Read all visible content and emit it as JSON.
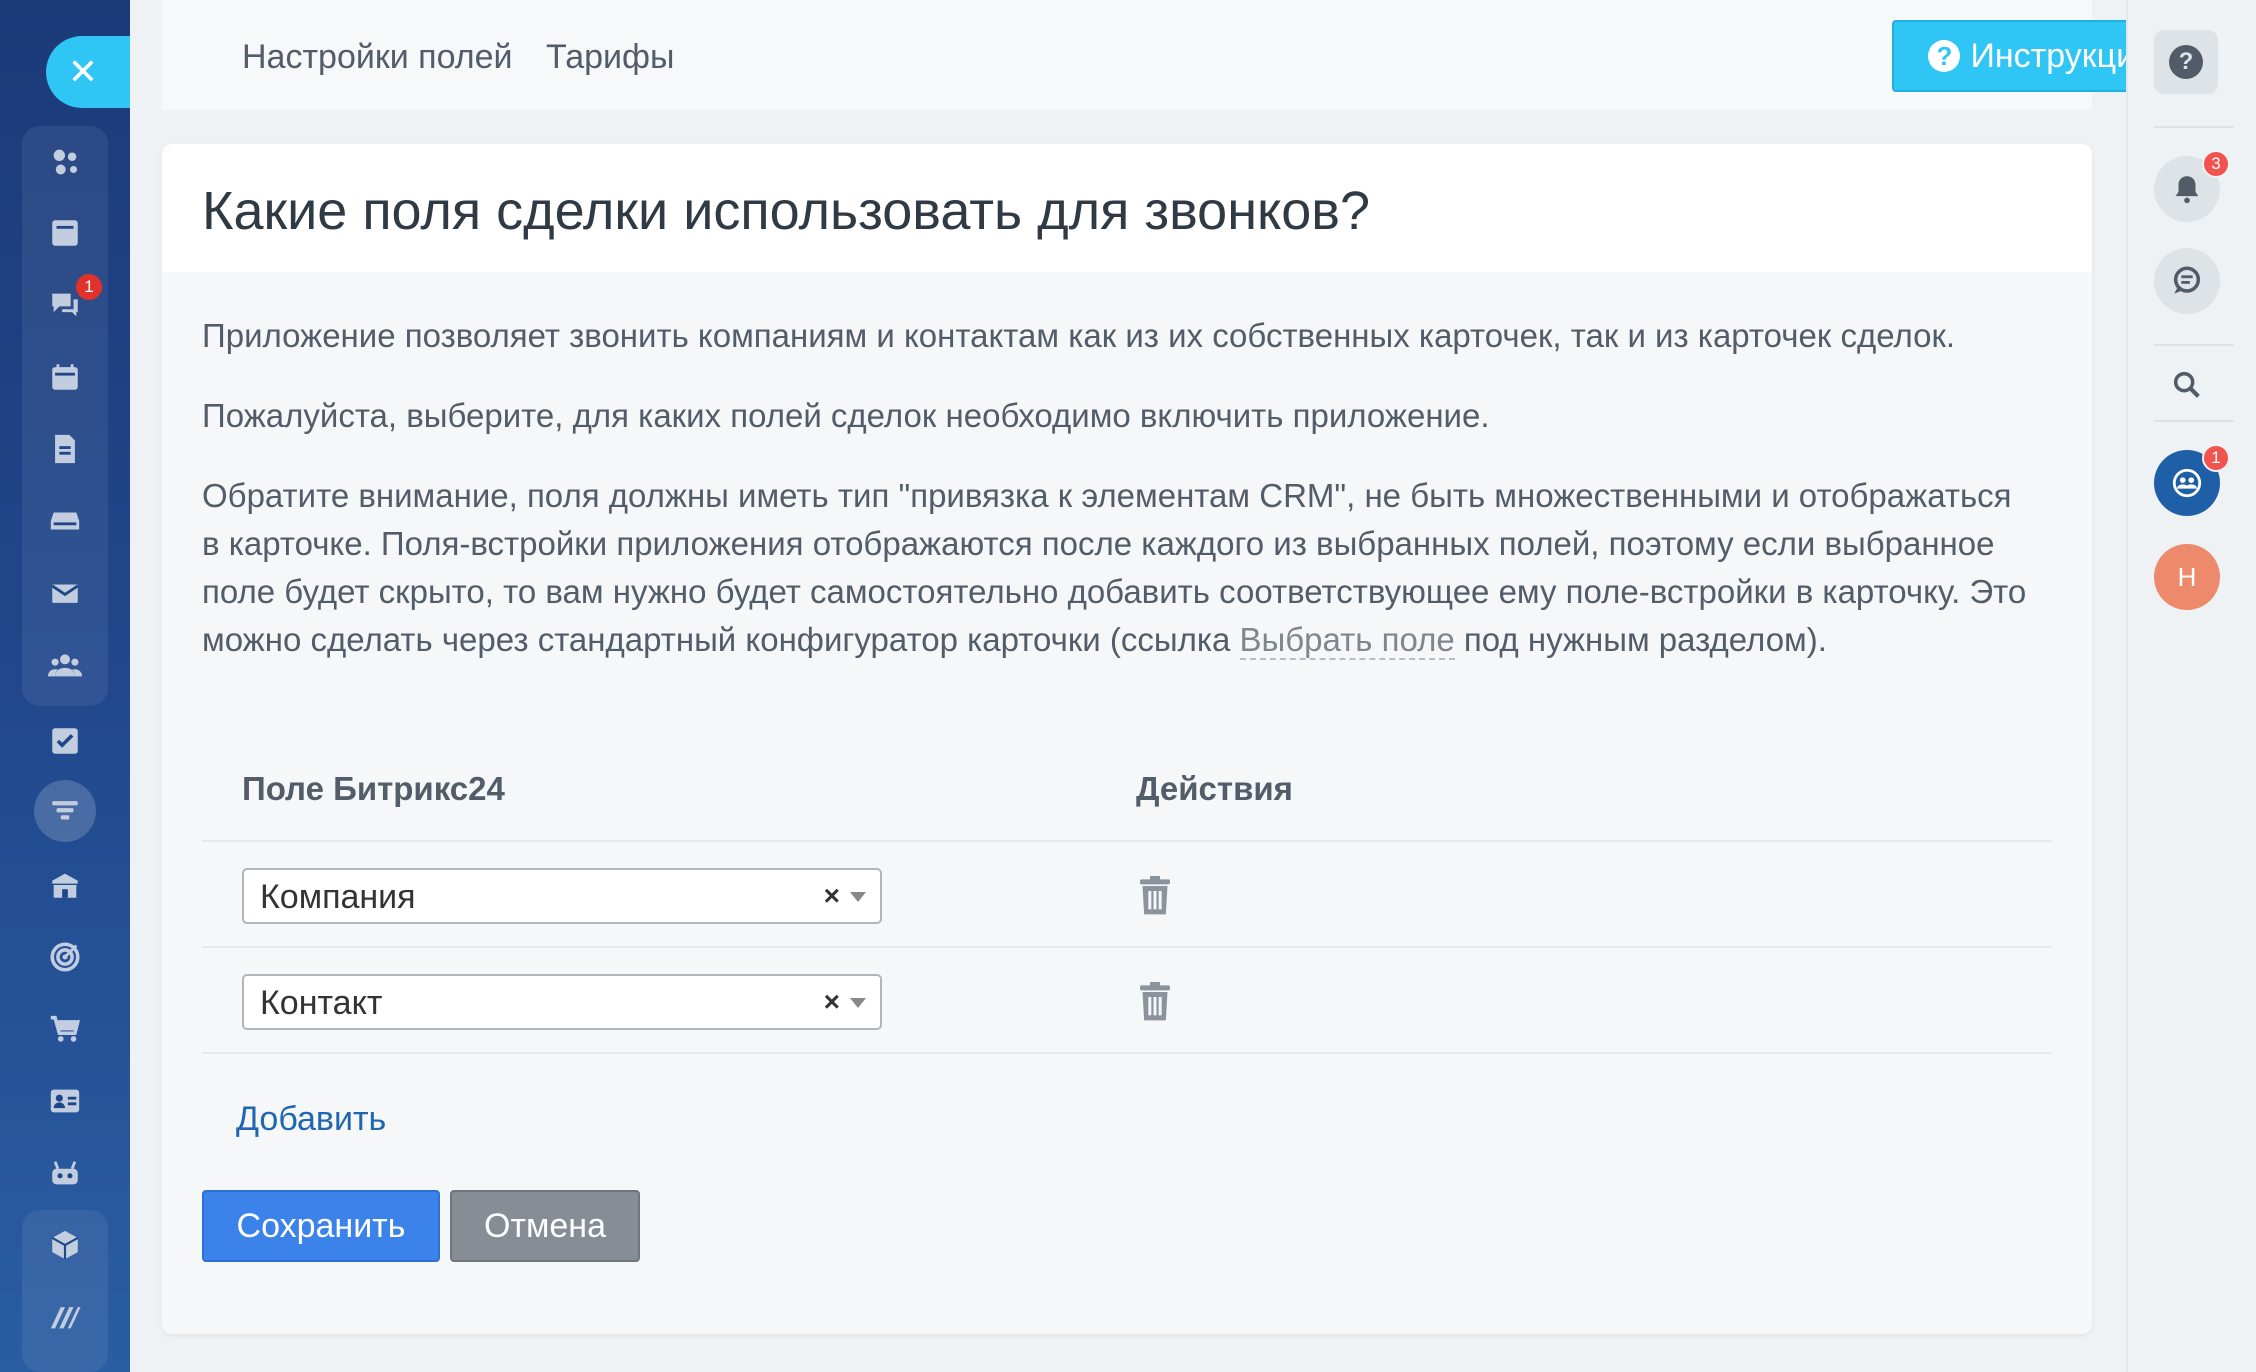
{
  "left_sidebar": {
    "close_icon": "✕",
    "items": [
      {
        "name": "feed-icon"
      },
      {
        "name": "news-icon"
      },
      {
        "name": "chat-icon",
        "badge": "1"
      },
      {
        "name": "calendar-icon"
      },
      {
        "name": "document-icon"
      },
      {
        "name": "drive-icon"
      },
      {
        "name": "mail-icon"
      },
      {
        "name": "group-icon"
      },
      {
        "name": "task-icon"
      },
      {
        "name": "crm-funnel-icon"
      },
      {
        "name": "store-icon"
      },
      {
        "name": "target-icon"
      },
      {
        "name": "cart-icon"
      },
      {
        "name": "contact-card-icon"
      },
      {
        "name": "robot-icon"
      },
      {
        "name": "box-icon"
      },
      {
        "name": "marketplace-icon"
      }
    ]
  },
  "top_panel": {
    "links": [
      "Настройки полей",
      "Тарифы"
    ],
    "instruction_button": "Инструкция",
    "instruction_icon": "?"
  },
  "card": {
    "title": "Какие поля сделки использовать для звонков?",
    "para1": "Приложение позволяет звонить компаниям и контактам как из их собственных карточек, так и из карточек сделок.",
    "para2": "Пожалуйста, выберите, для каких полей сделок необходимо включить приложение.",
    "para3_part1": "Обратите внимание, поля должны иметь тип \"привязка к элементам CRM\", не быть множественными и отображаться в карточке. Поля-встройки приложения отображаются после каждого из выбранных полей, поэтому если выбранное поле будет скрыто, то вам нужно будет самостоятельно добавить соответствующее ему поле-встройки в карточку. Это можно сделать через стандартный конфигуратор карточки (ссылка ",
    "para3_link": "Выбрать поле",
    "para3_part2": " под нужным разделом).",
    "table": {
      "headers": [
        "Поле Битрикс24",
        "Действия"
      ],
      "rows": [
        {
          "field": "Компания",
          "clear": "×"
        },
        {
          "field": "Контакт",
          "clear": "×"
        }
      ]
    },
    "add_link": "Добавить",
    "save_button": "Сохранить",
    "cancel_button": "Отмена"
  },
  "right_sidebar": {
    "help_icon": "?",
    "notifications_badge": "3",
    "open_lines_badge": "1",
    "avatar_initial": "Н",
    "colors": {
      "badge": "#f1534e",
      "avatar": "#ee8a6c",
      "open_lines": "#1e5fa8"
    }
  },
  "colors": {
    "accent": "#2fc6f6",
    "primary": "#3b82ea",
    "link": "#2067b0",
    "sidebar": "#1c3a78"
  }
}
